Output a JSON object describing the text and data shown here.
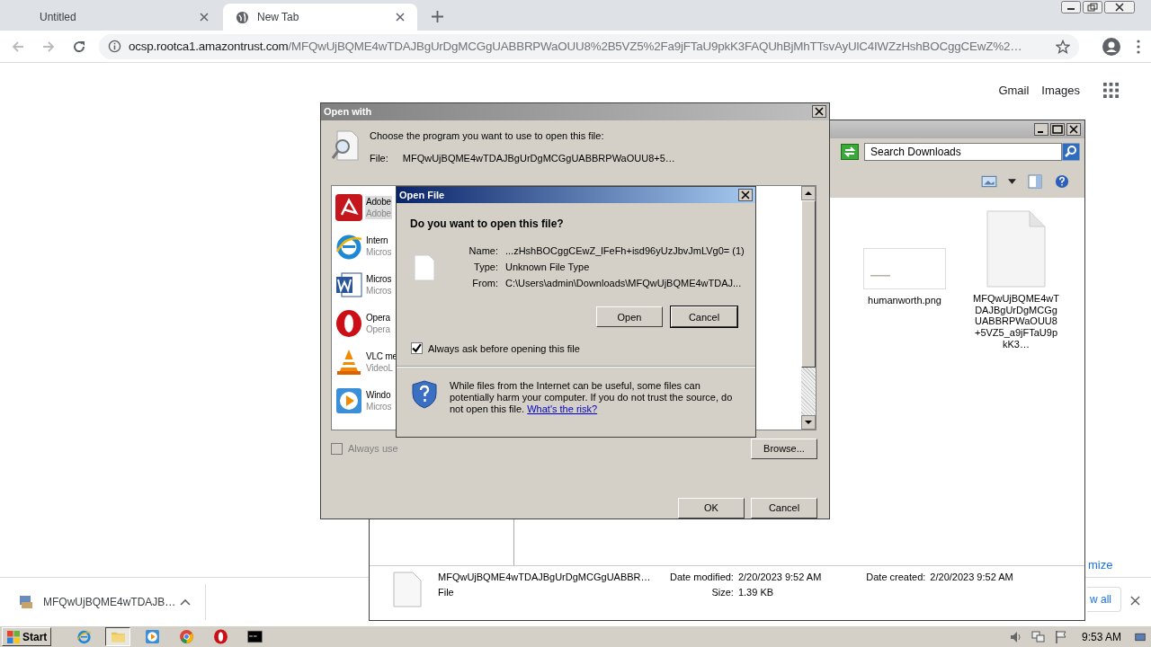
{
  "browser": {
    "tabs": [
      {
        "title": "Untitled",
        "kind": "blank",
        "selected": false
      },
      {
        "title": "New Tab",
        "kind": "web",
        "selected": true
      }
    ],
    "url": {
      "host": "ocsp.rootca1.amazontrust.com",
      "path": "/MFQwUjBQME4wTDAJBgUrDgMCGgUABBRPWaOUU8%2B5VZ5%2Fa9jFTaU9pkK3FAQUhBjMhTTsvAyUlC4IWZzHshBOCggCEwZ%2…"
    },
    "links": [
      "Gmail",
      "Images"
    ]
  },
  "download_shelf": {
    "items": [
      {
        "name": "MFQwUjBQME4wTDAJB…"
      }
    ],
    "bubble_text": "mize",
    "show_all": "w all"
  },
  "explorer": {
    "search": {
      "placeholder": "Search Downloads"
    },
    "files": [
      {
        "kind": "picture",
        "name": "humanworth.png"
      },
      {
        "kind": "document",
        "name": "MFQwUjBQME4wTDAJBgUrDgMCGgUABBRPWaOUU8+5VZ5_a9jFTaU9pkK3…"
      }
    ],
    "details": {
      "name": "MFQwUjBQME4wTDAJBgUrDgMCGgUABBR…",
      "type": "File",
      "fields": [
        {
          "label": "Date modified:",
          "value": "2/20/2023 9:52 AM"
        },
        {
          "label": "Size:",
          "value": "1.39 KB"
        },
        {
          "label": "Date created:",
          "value": "2/20/2023 9:52 AM"
        }
      ]
    }
  },
  "open_with": {
    "title": "Open with",
    "prompt": "Choose the program you want to use to open this file:",
    "file_label": "File:",
    "file_name": "MFQwUjBQME4wTDAJBgUrDgMCGgUABBRPWaOUU8+5…",
    "programs": [
      {
        "kind": "pdf",
        "name": "Adobe",
        "publisher": "Adobe",
        "selected": true
      },
      {
        "kind": "ie",
        "name": "Intern",
        "publisher": "Micros",
        "selected": false
      },
      {
        "kind": "word",
        "name": "Micros",
        "publisher": "Micros",
        "selected": false
      },
      {
        "kind": "opera",
        "name": "Opera",
        "publisher": "Opera",
        "selected": false
      },
      {
        "kind": "vlc",
        "name": "VLC me",
        "publisher": "VideoL",
        "selected": false
      },
      {
        "kind": "media",
        "name": "Windo",
        "publisher": "Micros",
        "selected": false
      }
    ],
    "always_use": {
      "label": "Always use",
      "checked": false,
      "disabled": true
    },
    "buttons": {
      "browse": "Browse...",
      "ok": "OK",
      "cancel": "Cancel"
    }
  },
  "open_file": {
    "title": "Open File",
    "question": "Do you want to open this file?",
    "fields": [
      {
        "label": "Name:",
        "value": "...zHshBOCggCEwZ_lFeFh+isd96yUzJbvJmLVg0= (1)"
      },
      {
        "label": "Type:",
        "value": "Unknown File Type"
      },
      {
        "label": "From:",
        "value": "C:\\Users\\admin\\Downloads\\MFQwUjBQME4wTDAJ..."
      }
    ],
    "buttons": {
      "open": "Open",
      "cancel": "Cancel"
    },
    "always_ask": {
      "label": "Always ask before opening this file",
      "checked": true
    },
    "warning": "While files from the Internet can be useful, some files can potentially harm your computer. If you do not trust the source, do not open this file.",
    "risk_link": "What's the risk?"
  },
  "taskbar": {
    "start": "Start",
    "apps": [
      {
        "kind": "ie",
        "selected": false
      },
      {
        "kind": "folder",
        "selected": true
      },
      {
        "kind": "media",
        "selected": false
      },
      {
        "kind": "chrome",
        "selected": false
      },
      {
        "kind": "opera",
        "selected": false
      },
      {
        "kind": "cmd",
        "selected": false
      }
    ],
    "clock": "9:53 AM"
  }
}
